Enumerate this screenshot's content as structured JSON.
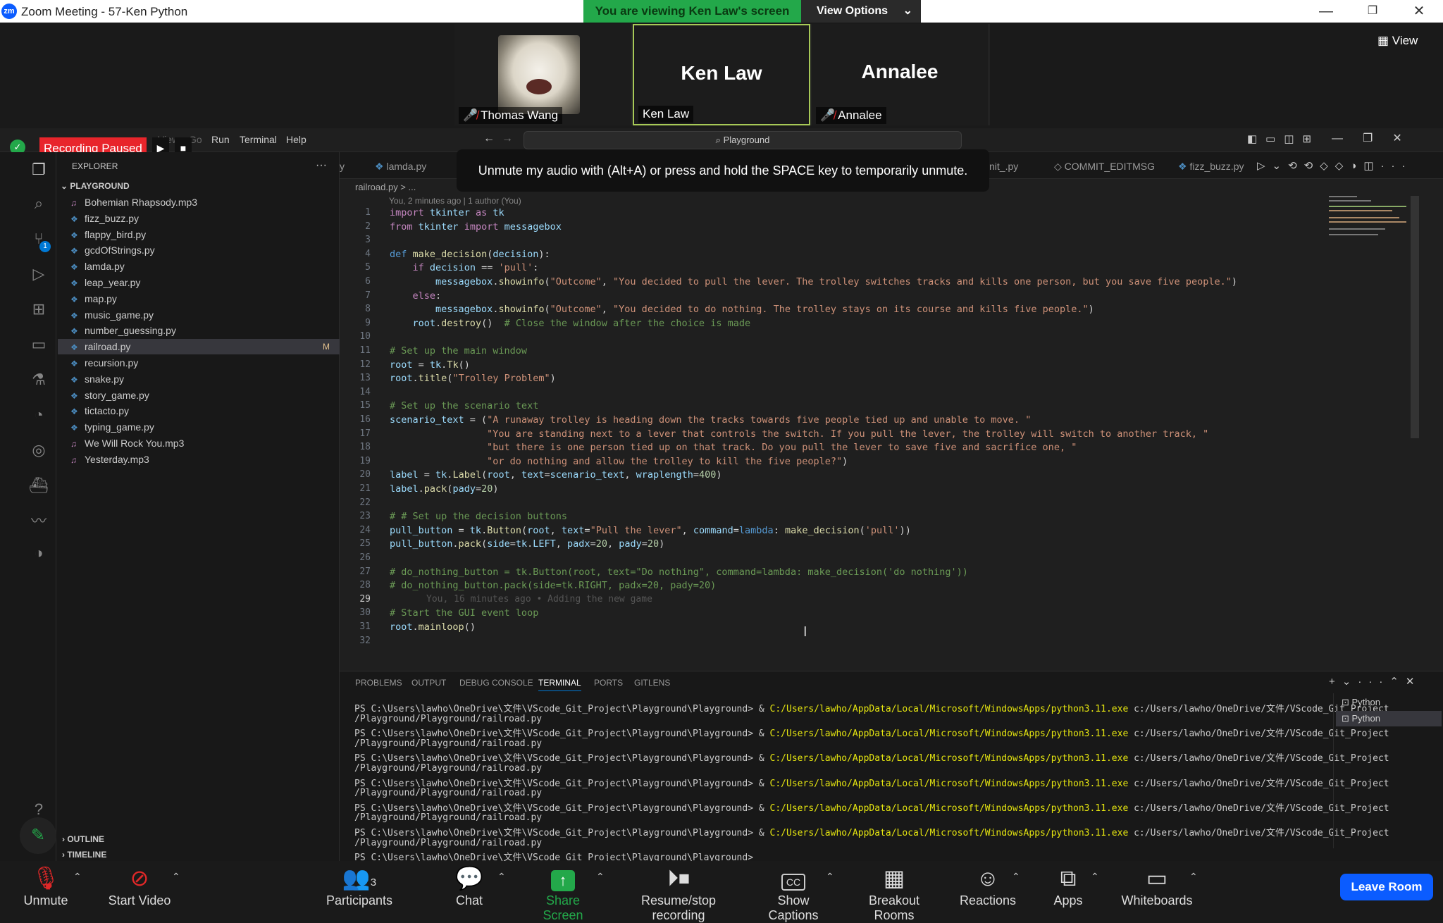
{
  "window": {
    "title": "Zoom Meeting - 57-Ken Python",
    "logo": "zm"
  },
  "banner": {
    "viewing": "You are viewing Ken Law's screen",
    "view_options": "View Options"
  },
  "participants_strip": {
    "tiles": [
      {
        "name": "Thomas Wang",
        "big_name": "",
        "muted": true
      },
      {
        "name": "Ken Law",
        "big_name": "Ken Law",
        "muted": false
      },
      {
        "name": "Annalee",
        "big_name": "Annalee",
        "muted": true
      }
    ],
    "view_button": "View"
  },
  "recording": {
    "status": "Recording Paused"
  },
  "vscode": {
    "menu": [
      "View",
      "Go",
      "Run",
      "Terminal",
      "Help"
    ],
    "command_center": "Playground",
    "explorer_title": "EXPLORER",
    "workspace": "PLAYGROUND",
    "files": [
      {
        "name": "Bohemian Rhapsody.mp3",
        "kind": "audio"
      },
      {
        "name": "fizz_buzz.py",
        "kind": "py"
      },
      {
        "name": "flappy_bird.py",
        "kind": "py"
      },
      {
        "name": "gcdOfStrings.py",
        "kind": "py"
      },
      {
        "name": "lamda.py",
        "kind": "py"
      },
      {
        "name": "leap_year.py",
        "kind": "py"
      },
      {
        "name": "map.py",
        "kind": "py"
      },
      {
        "name": "music_game.py",
        "kind": "py"
      },
      {
        "name": "number_guessing.py",
        "kind": "py"
      },
      {
        "name": "railroad.py",
        "kind": "py",
        "active": true,
        "mark": "M"
      },
      {
        "name": "recursion.py",
        "kind": "py"
      },
      {
        "name": "snake.py",
        "kind": "py"
      },
      {
        "name": "story_game.py",
        "kind": "py"
      },
      {
        "name": "tictacto.py",
        "kind": "py"
      },
      {
        "name": "typing_game.py",
        "kind": "py"
      },
      {
        "name": "We Will Rock You.mp3",
        "kind": "audio"
      },
      {
        "name": "Yesterday.mp3",
        "kind": "audio"
      }
    ],
    "outline": "OUTLINE",
    "timeline": "TIMELINE",
    "tabs": [
      "lamda.py",
      "nit_.py",
      "COMMIT_EDITMSG",
      "fizz_buzz.py"
    ],
    "toast": "Unmute my audio with (Alt+A) or press and hold the SPACE key to temporarily unmute.",
    "breadcrumb": "railroad.py > ...",
    "blame": "You, 2 minutes ago | 1 author (You)",
    "inline_blame": "You, 16 minutes ago • Adding the new game",
    "code_lines": [
      "import tkinter as tk",
      "from tkinter import messagebox",
      "",
      "def make_decision(decision):",
      "    if decision == 'pull':",
      "        messagebox.showinfo(\"Outcome\", \"You decided to pull the lever. The trolley switches tracks and kills one person, but you save five people.\")",
      "    else:",
      "        messagebox.showinfo(\"Outcome\", \"You decided to do nothing. The trolley stays on its course and kills five people.\")",
      "    root.destroy()  # Close the window after the choice is made",
      "",
      "# Set up the main window",
      "root = tk.Tk()",
      "root.title(\"Trolley Problem\")",
      "",
      "# Set up the scenario text",
      "scenario_text = (\"A runaway trolley is heading down the tracks towards five people tied up and unable to move. \"",
      "                 \"You are standing next to a lever that controls the switch. If you pull the lever, the trolley will switch to another track, \"",
      "                 \"but there is one person tied up on that track. Do you pull the lever to save five and sacrifice one, \"",
      "                 \"or do nothing and allow the trolley to kill the five people?\")",
      "label = tk.Label(root, text=scenario_text, wraplength=400)",
      "label.pack(pady=20)",
      "",
      "# # Set up the decision buttons",
      "pull_button = tk.Button(root, text=\"Pull the lever\", command=lambda: make_decision('pull'))",
      "pull_button.pack(side=tk.LEFT, padx=20, pady=20)",
      "",
      "# do_nothing_button = tk.Button(root, text=\"Do nothing\", command=lambda: make_decision('do nothing'))",
      "# do_nothing_button.pack(side=tk.RIGHT, padx=20, pady=20)",
      "",
      "# Start the GUI event loop",
      "root.mainloop()",
      ""
    ],
    "panel_tabs": [
      "PROBLEMS",
      "OUTPUT",
      "DEBUG CONSOLE",
      "TERMINAL",
      "PORTS",
      "GITLENS"
    ],
    "active_panel_tab": "TERMINAL",
    "terminal": {
      "prompt": "PS C:\\Users\\lawho\\OneDrive\\文件\\VScode_Git_Project\\Playground\\Playground> & ",
      "exe": "C:/Users/lawho/AppData/Local/Microsoft/WindowsApps/python3.11.exe",
      "arg": " c:/Users/lawho/OneDrive/文件/VScode_Git_Project",
      "cont": "/Playground/Playground/railroad.py",
      "final": "PS C:\\Users\\lawho\\OneDrive\\文件\\VScode_Git_Project\\Playground\\Playground>"
    },
    "terminal_list": [
      "Python",
      "Python"
    ]
  },
  "toolbar": {
    "unmute": "Unmute",
    "start_video": "Start Video",
    "participants": "Participants",
    "participants_count": "3",
    "chat": "Chat",
    "share_screen": "Share Screen",
    "recording": "Resume/stop recording",
    "captions": "Show Captions",
    "breakout": "Breakout Rooms",
    "reactions": "Reactions",
    "apps": "Apps",
    "whiteboards": "Whiteboards",
    "leave": "Leave Room"
  },
  "colors": {
    "zoom_green": "#23a84a",
    "zoom_blue": "#0b5cff",
    "record_red": "#e8252b",
    "vscode_bg": "#1f1f1f"
  }
}
